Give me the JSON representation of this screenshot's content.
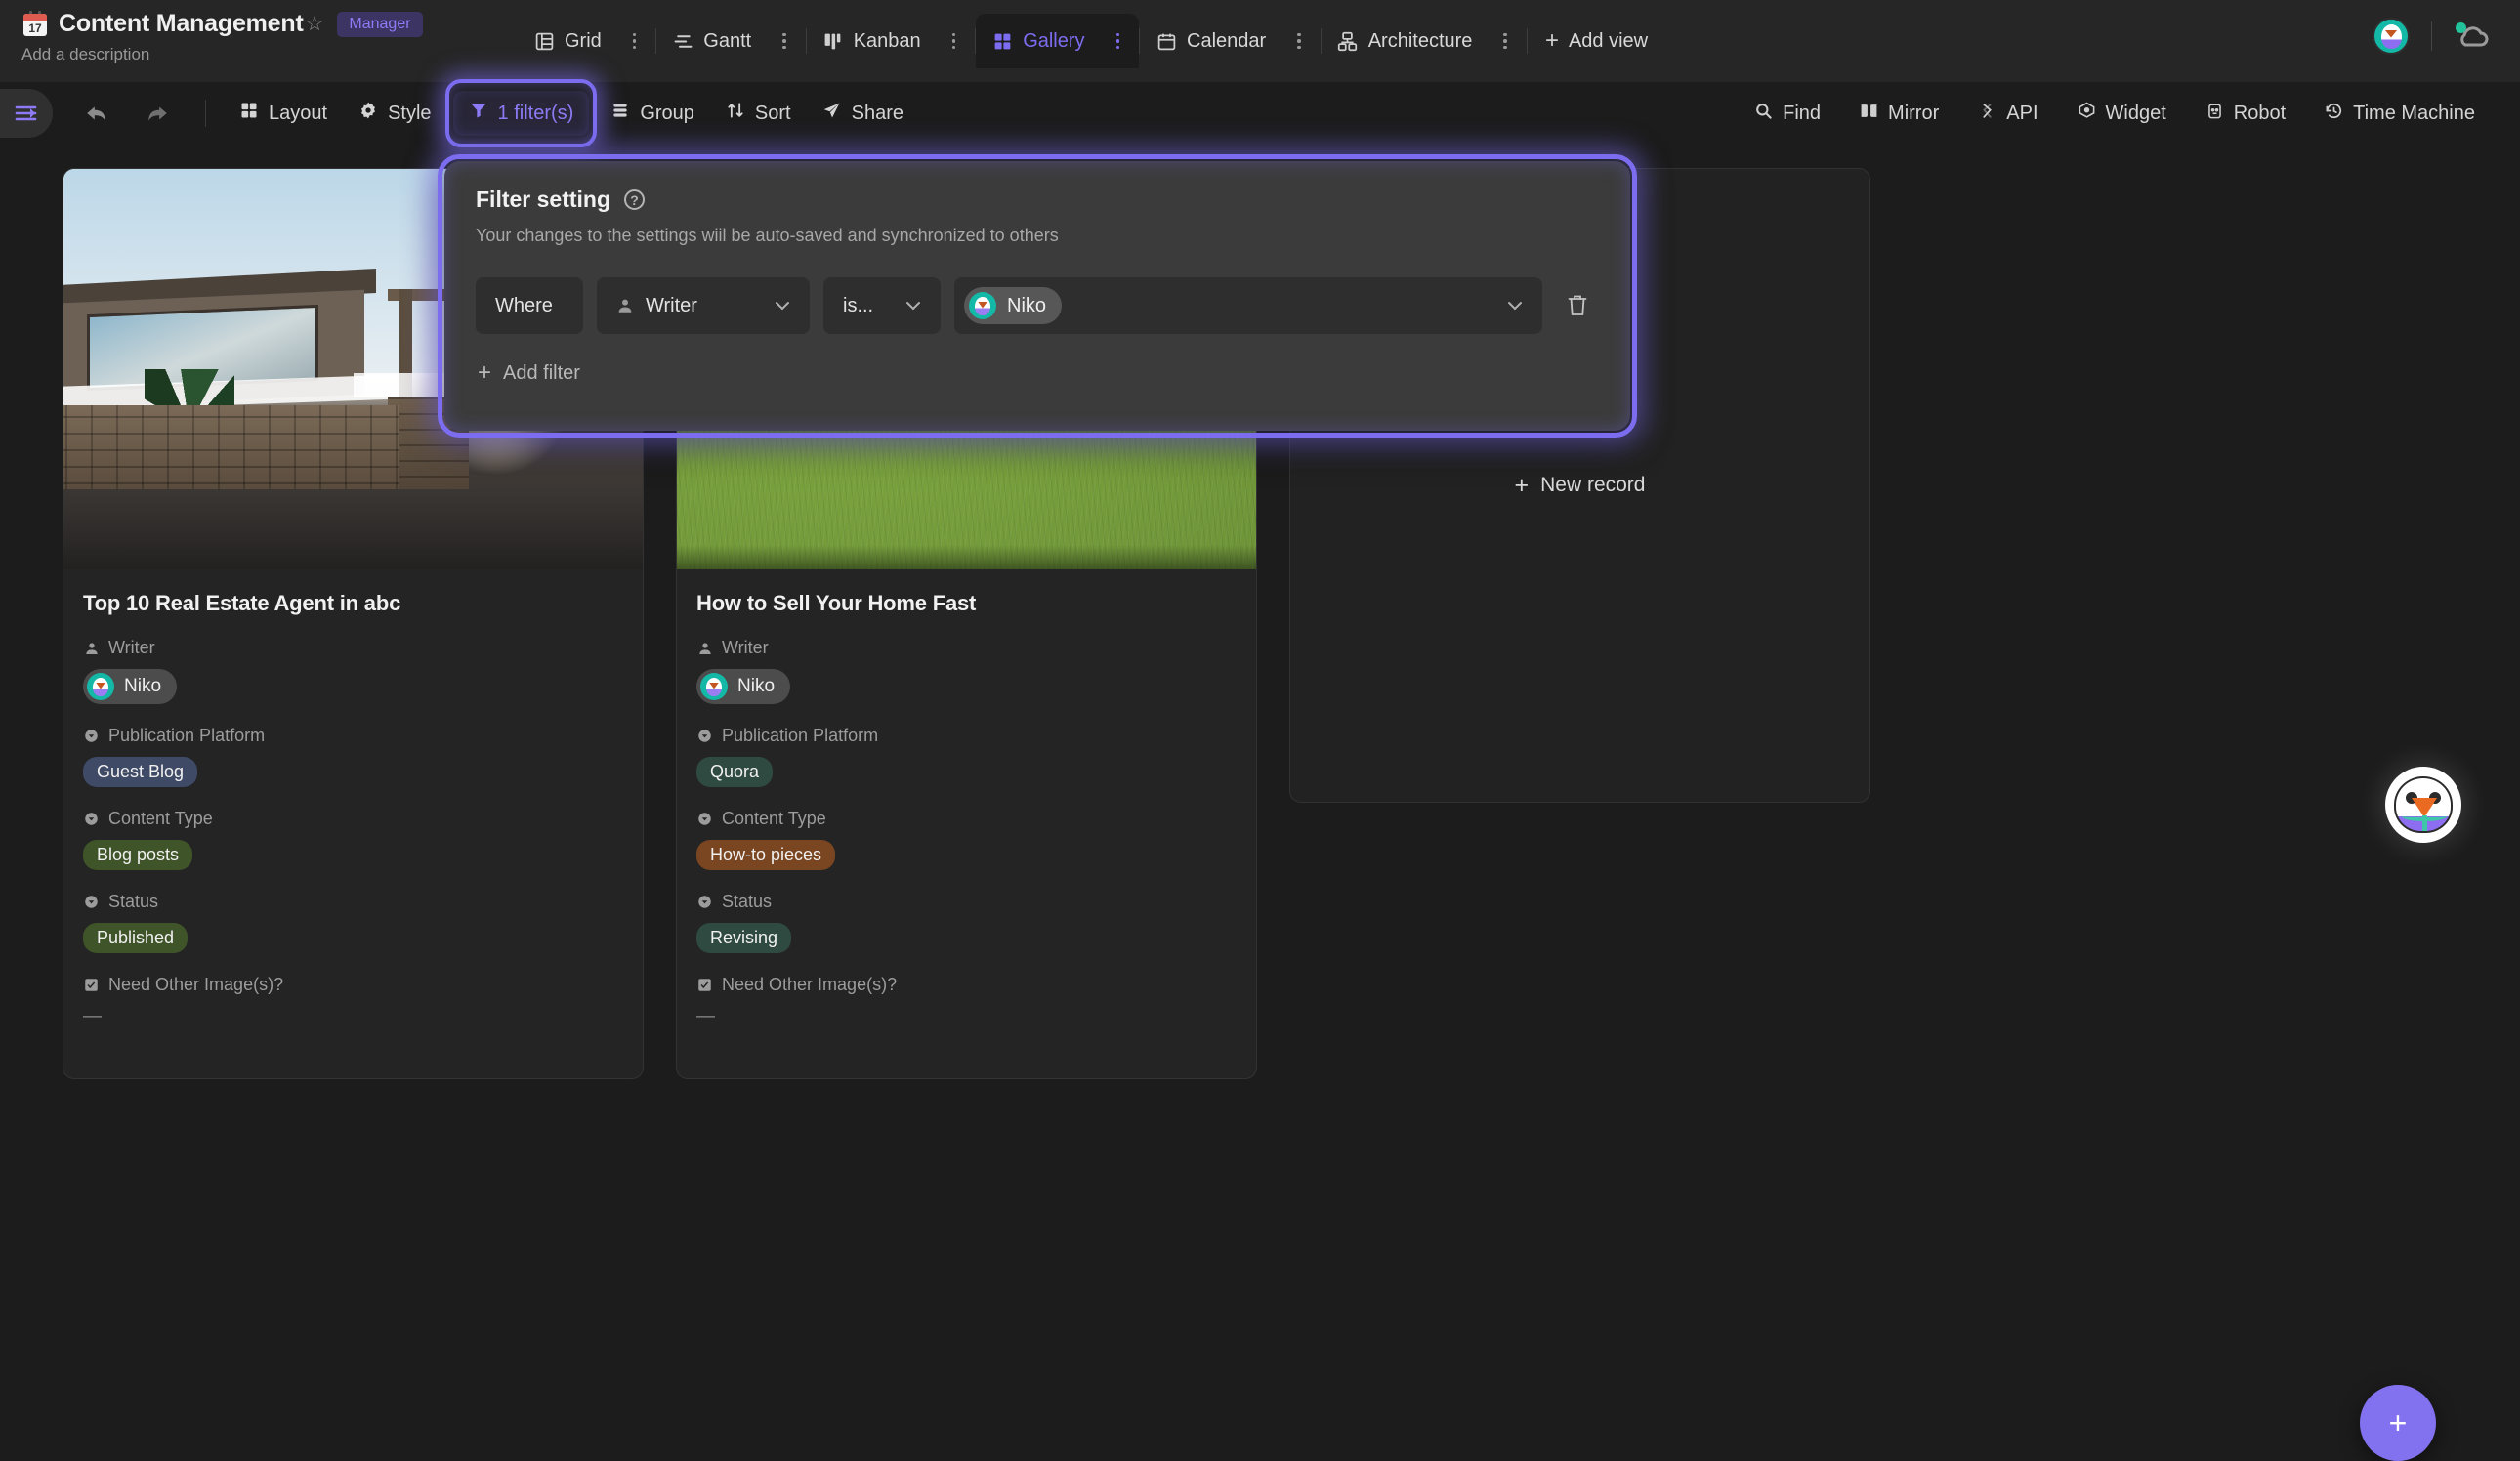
{
  "header": {
    "doc_icon": "calendar-icon",
    "doc_day": "17",
    "title": "Content Management",
    "star": "☆",
    "role_badge": "Manager",
    "description_placeholder": "Add a description"
  },
  "view_tabs": [
    {
      "label": "Grid",
      "icon": "grid-icon",
      "active": false
    },
    {
      "label": "Gantt",
      "icon": "gantt-icon",
      "active": false
    },
    {
      "label": "Kanban",
      "icon": "kanban-icon",
      "active": false
    },
    {
      "label": "Gallery",
      "icon": "gallery-icon",
      "active": true
    },
    {
      "label": "Calendar",
      "icon": "calendar-view-icon",
      "active": false
    },
    {
      "label": "Architecture",
      "icon": "architecture-icon",
      "active": false
    }
  ],
  "add_view_label": "Add view",
  "toolbar": {
    "left": [
      {
        "label": "Layout",
        "icon": "layout-icon"
      },
      {
        "label": "Style",
        "icon": "style-gear-icon"
      }
    ],
    "filter_label": "1 filter(s)",
    "after_filter": [
      {
        "label": "Group",
        "icon": "group-icon"
      },
      {
        "label": "Sort",
        "icon": "sort-icon"
      },
      {
        "label": "Share",
        "icon": "share-icon"
      }
    ],
    "right": [
      {
        "label": "Find",
        "icon": "search-icon"
      },
      {
        "label": "Mirror",
        "icon": "mirror-icon"
      },
      {
        "label": "API",
        "icon": "api-icon"
      },
      {
        "label": "Widget",
        "icon": "widget-icon"
      },
      {
        "label": "Robot",
        "icon": "robot-icon"
      },
      {
        "label": "Time Machine",
        "icon": "time-machine-icon"
      }
    ]
  },
  "filter_panel": {
    "title": "Filter setting",
    "subtitle": "Your changes to the settings wiil be auto-saved and synchronized to others",
    "where_label": "Where",
    "field_value": "Writer",
    "operator_value": "is...",
    "selected_value": "Niko",
    "add_filter_label": "Add filter",
    "accent_color": "#7c6df0"
  },
  "gallery": {
    "cards": [
      {
        "title": "Top 10 Real Estate Agent in abc",
        "image": "modern-stone-house-at-sunset-photo",
        "fields": [
          {
            "label": "Writer",
            "icon": "person-icon",
            "type": "person",
            "value": "Niko"
          },
          {
            "label": "Publication Platform",
            "icon": "select-icon",
            "type": "tag",
            "value": "Guest Blog",
            "color": "#3f4a66"
          },
          {
            "label": "Content Type",
            "icon": "select-icon",
            "type": "tag",
            "value": "Blog posts",
            "color": "#3f5428"
          },
          {
            "label": "Status",
            "icon": "select-icon",
            "type": "tag",
            "value": "Published",
            "color": "#3f5428"
          },
          {
            "label": "Need Other Image(s)?",
            "icon": "checkbox-icon",
            "type": "text",
            "value": "—"
          }
        ]
      },
      {
        "title": "How to Sell Your Home Fast",
        "image": "green-lawn-with-wooden-post-photo",
        "fields": [
          {
            "label": "Writer",
            "icon": "person-icon",
            "type": "person",
            "value": "Niko"
          },
          {
            "label": "Publication Platform",
            "icon": "select-icon",
            "type": "tag",
            "value": "Quora",
            "color": "#2f4a40"
          },
          {
            "label": "Content Type",
            "icon": "select-icon",
            "type": "tag",
            "value": "How-to pieces",
            "color": "#7a4521"
          },
          {
            "label": "Status",
            "icon": "select-icon",
            "type": "tag",
            "value": "Revising",
            "color": "#2f4a40"
          },
          {
            "label": "Need Other Image(s)?",
            "icon": "checkbox-icon",
            "type": "text",
            "value": "—"
          }
        ]
      }
    ],
    "new_record_label": "New record"
  },
  "floating": {
    "mascot": "owl-mascot-avatar",
    "add_button": "+"
  }
}
